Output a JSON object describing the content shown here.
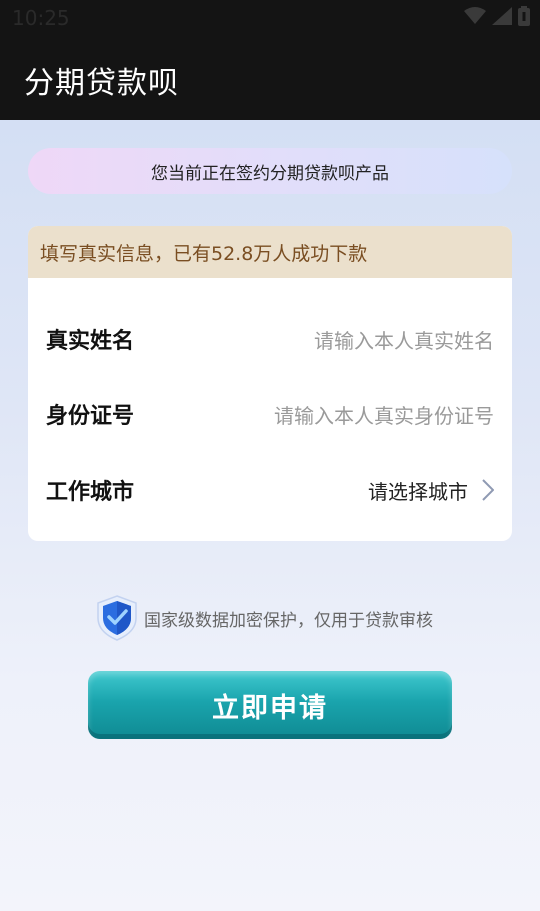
{
  "status_bar": {
    "time": "10:25",
    "icons": [
      "wifi-icon",
      "signal-icon",
      "battery-icon"
    ]
  },
  "app_bar": {
    "title": "分期贷款呗"
  },
  "notice": {
    "text": "您当前正在签约分期贷款呗产品"
  },
  "form": {
    "header": "填写真实信息，已有52.8万人成功下款",
    "fields": [
      {
        "label": "真实姓名",
        "placeholder": "请输入本人真实姓名"
      },
      {
        "label": "身份证号",
        "placeholder": "请输入本人真实身份证号"
      },
      {
        "label": "工作城市",
        "value": "请选择城市",
        "icon": "chevron-right-icon"
      }
    ]
  },
  "security": {
    "icon": "shield-check-icon",
    "text": "国家级数据加密保护，仅用于贷款审核"
  },
  "apply_button": {
    "label": "立即申请"
  },
  "colors": {
    "top_bar": "#141414",
    "card_header_bg": "#ebe0cc",
    "card_header_text": "#7a4e22",
    "button": "#1aa4ad"
  }
}
